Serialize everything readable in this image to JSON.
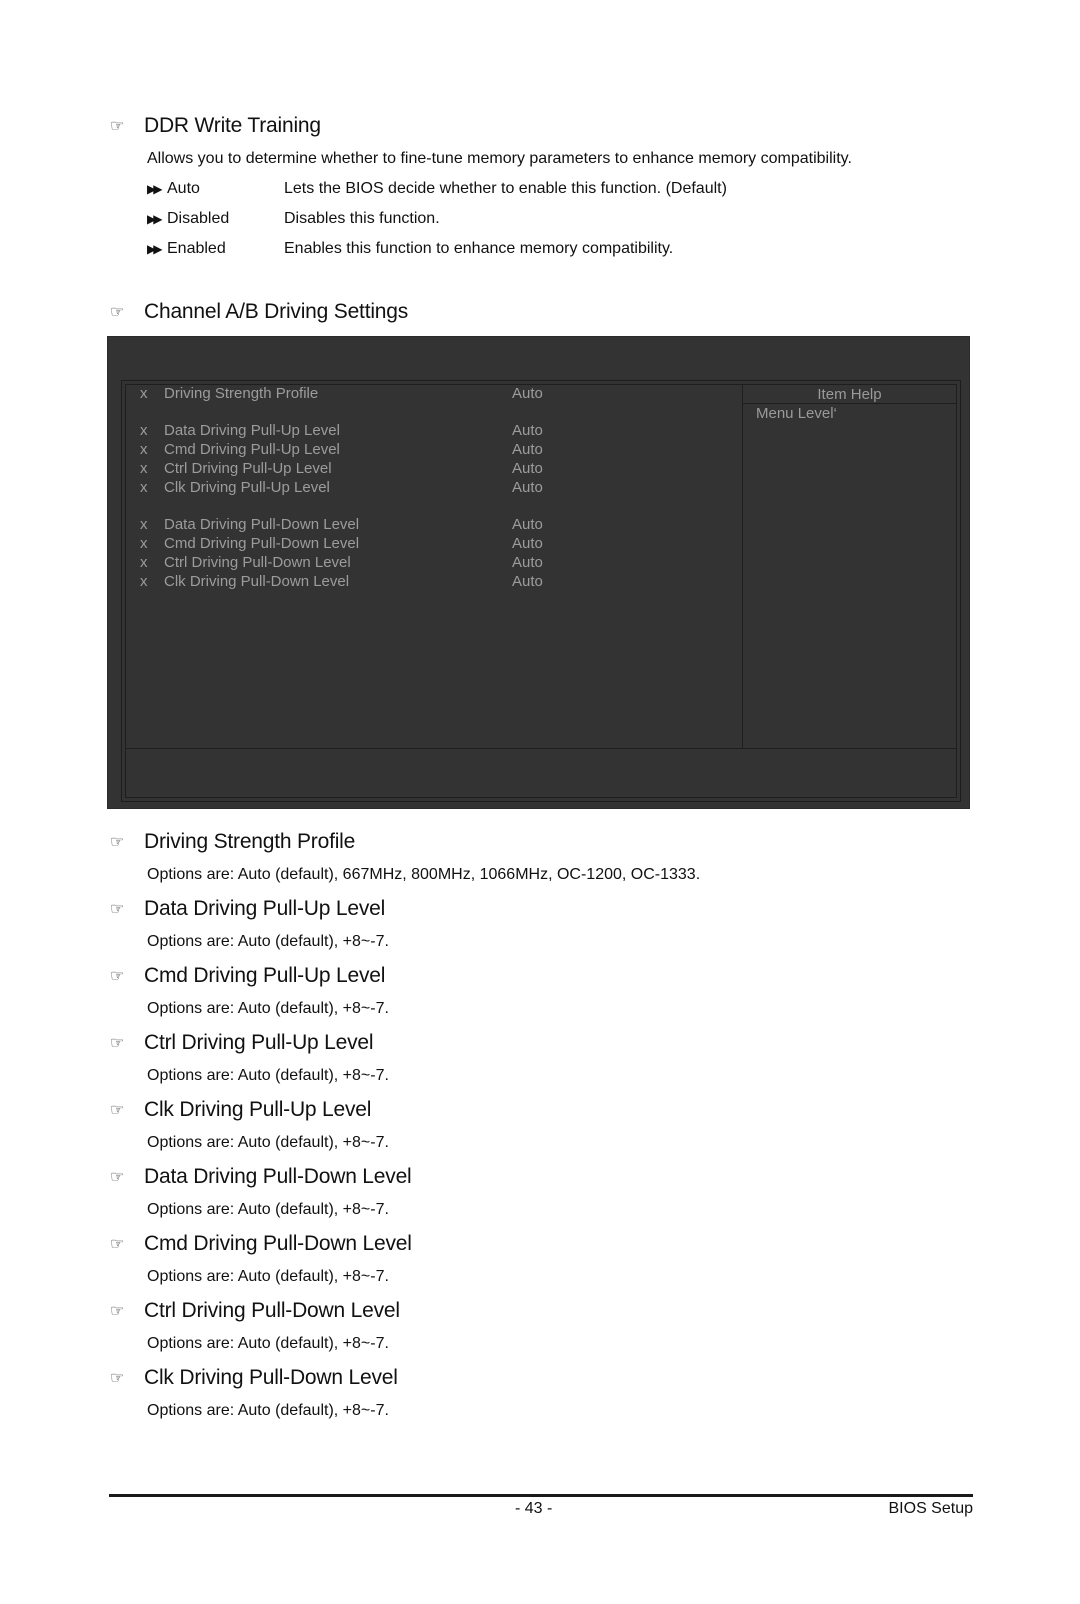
{
  "ddr_write_training": {
    "title": "DDR Write Training",
    "description": "Allows you to determine whether to fine-tune memory parameters to enhance memory compatibility.",
    "options": [
      {
        "name": "Auto",
        "desc": "Lets the BIOS decide whether to enable this function. (Default)"
      },
      {
        "name": "Disabled",
        "desc": "Disables this function."
      },
      {
        "name": "Enabled",
        "desc": "Enables this function to enhance memory compatibility."
      }
    ]
  },
  "channel_settings": {
    "title": "Channel A/B Driving Settings"
  },
  "bios_screen": {
    "help_header": "Item Help",
    "help_text": "Menu Level‘",
    "items": [
      {
        "marker": "x",
        "label": "Driving Strength Profile",
        "value": "Auto"
      },
      {
        "marker": "x",
        "label": "Data Driving Pull-Up Level",
        "value": "Auto"
      },
      {
        "marker": "x",
        "label": "Cmd Driving Pull-Up Level",
        "value": "Auto"
      },
      {
        "marker": "x",
        "label": "Ctrl Driving Pull-Up Level",
        "value": "Auto"
      },
      {
        "marker": "x",
        "label": "Clk Driving Pull-Up Level",
        "value": "Auto"
      },
      {
        "marker": "x",
        "label": "Data Driving Pull-Down Level",
        "value": "Auto"
      },
      {
        "marker": "x",
        "label": "Cmd Driving Pull-Down Level",
        "value": "Auto"
      },
      {
        "marker": "x",
        "label": "Ctrl Driving Pull-Down Level",
        "value": "Auto"
      },
      {
        "marker": "x",
        "label": "Clk Driving Pull-Down Level",
        "value": "Auto"
      }
    ]
  },
  "sections": [
    {
      "title": "Driving Strength Profile",
      "text": "Options are: Auto (default), 667MHz, 800MHz, 1066MHz, OC-1200, OC-1333."
    },
    {
      "title": "Data Driving Pull-Up Level",
      "text": "Options are: Auto (default), +8~-7."
    },
    {
      "title": "Cmd Driving Pull-Up Level",
      "text": "Options are: Auto (default), +8~-7."
    },
    {
      "title": "Ctrl Driving Pull-Up Level",
      "text": "Options are: Auto (default), +8~-7."
    },
    {
      "title": "Clk Driving Pull-Up Level",
      "text": "Options are: Auto (default), +8~-7."
    },
    {
      "title": "Data Driving Pull-Down Level",
      "text": "Options are: Auto (default), +8~-7."
    },
    {
      "title": "Cmd Driving Pull-Down Level",
      "text": "Options are: Auto (default), +8~-7."
    },
    {
      "title": "Ctrl Driving Pull-Down Level",
      "text": "Options are: Auto (default), +8~-7."
    },
    {
      "title": "Clk Driving Pull-Down Level",
      "text": "Options are: Auto (default), +8~-7."
    }
  ],
  "icons": {
    "hand": "☞",
    "arrow": "▶▶"
  },
  "footer": {
    "page_number": "- 43 -",
    "section": "BIOS Setup"
  }
}
